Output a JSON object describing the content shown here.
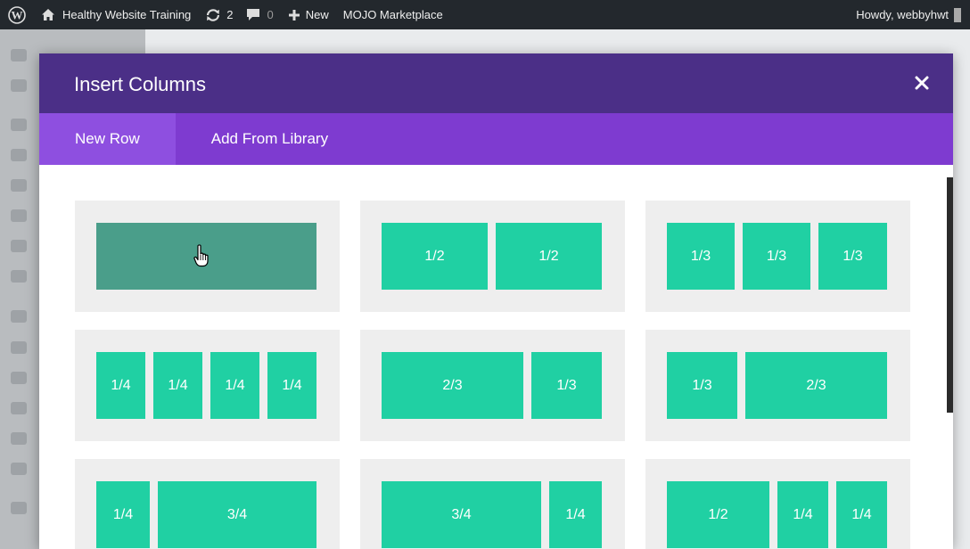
{
  "admin_bar": {
    "site_name": "Healthy Website Training",
    "updates_count": "2",
    "comments_count": "0",
    "new_label": "New",
    "mojo_label": "MOJO Marketplace",
    "howdy": "Howdy, webbyhwt"
  },
  "modal": {
    "title": "Insert Columns",
    "tabs": [
      {
        "label": "New Row",
        "active": true
      },
      {
        "label": "Add From Library",
        "active": false
      }
    ]
  },
  "layouts": [
    {
      "columns": [
        ""
      ]
    },
    {
      "columns": [
        "1/2",
        "1/2"
      ]
    },
    {
      "columns": [
        "1/3",
        "1/3",
        "1/3"
      ]
    },
    {
      "columns": [
        "1/4",
        "1/4",
        "1/4",
        "1/4"
      ]
    },
    {
      "columns": [
        "2/3",
        "1/3"
      ]
    },
    {
      "columns": [
        "1/3",
        "2/3"
      ]
    },
    {
      "columns": [
        "1/4",
        "3/4"
      ]
    },
    {
      "columns": [
        "3/4",
        "1/4"
      ]
    },
    {
      "columns": [
        "1/2",
        "1/4",
        "1/4"
      ]
    }
  ],
  "colors": {
    "header": "#4b2f87",
    "tabs": "#7e3bd0",
    "column": "#20d0a3",
    "column_hover": "#4a9e8a"
  },
  "icons": [
    "wordpress-icon",
    "home-icon",
    "updates-icon",
    "comment-icon",
    "plus-icon",
    "close-icon",
    "hand-cursor-icon"
  ]
}
